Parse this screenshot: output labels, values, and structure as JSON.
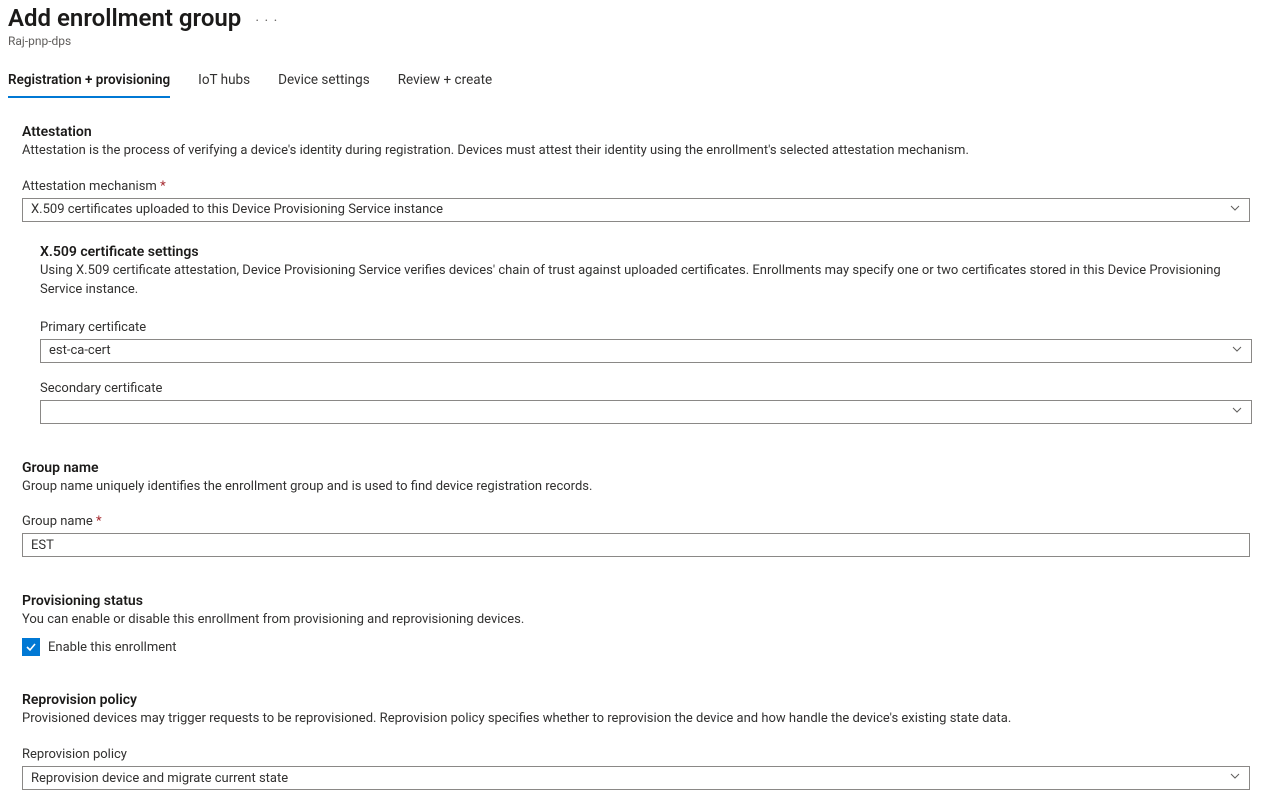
{
  "header": {
    "title": "Add enrollment group",
    "subtitle": "Raj-pnp-dps"
  },
  "tabs": [
    {
      "label": "Registration + provisioning",
      "active": true
    },
    {
      "label": "IoT hubs",
      "active": false
    },
    {
      "label": "Device settings",
      "active": false
    },
    {
      "label": "Review + create",
      "active": false
    }
  ],
  "attestation": {
    "title": "Attestation",
    "desc": "Attestation is the process of verifying a device's identity during registration. Devices must attest their identity using the enrollment's selected attestation mechanism.",
    "field_label": "Attestation mechanism",
    "value": "X.509 certificates uploaded to this Device Provisioning Service instance"
  },
  "x509": {
    "title": "X.509 certificate settings",
    "desc": "Using X.509 certificate attestation, Device Provisioning Service verifies devices' chain of trust against uploaded certificates. Enrollments may specify one or two certificates stored in this Device Provisioning Service instance.",
    "primary_label": "Primary certificate",
    "primary_value": "est-ca-cert",
    "secondary_label": "Secondary certificate",
    "secondary_value": ""
  },
  "group_name": {
    "title": "Group name",
    "desc": "Group name uniquely identifies the enrollment group and is used to find device registration records.",
    "field_label": "Group name",
    "value": "EST"
  },
  "provisioning_status": {
    "title": "Provisioning status",
    "desc": "You can enable or disable this enrollment from provisioning and reprovisioning devices.",
    "checkbox_label": "Enable this enrollment",
    "checked": true
  },
  "reprovision": {
    "title": "Reprovision policy",
    "desc": "Provisioned devices may trigger requests to be reprovisioned. Reprovision policy specifies whether to reprovision the device and how handle the device's existing state data.",
    "field_label": "Reprovision policy",
    "value": "Reprovision device and migrate current state"
  }
}
